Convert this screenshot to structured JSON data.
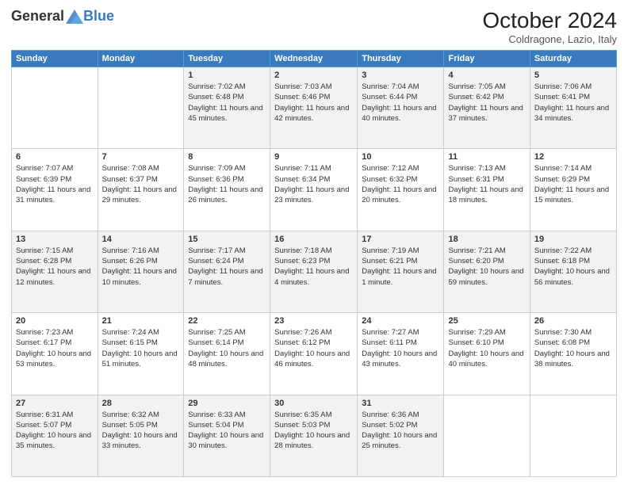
{
  "logo": {
    "general": "General",
    "blue": "Blue"
  },
  "header": {
    "title": "October 2024",
    "subtitle": "Coldragone, Lazio, Italy"
  },
  "days_of_week": [
    "Sunday",
    "Monday",
    "Tuesday",
    "Wednesday",
    "Thursday",
    "Friday",
    "Saturday"
  ],
  "weeks": [
    [
      null,
      null,
      {
        "day": 1,
        "sunrise": "Sunrise: 7:02 AM",
        "sunset": "Sunset: 6:48 PM",
        "daylight": "Daylight: 11 hours and 45 minutes."
      },
      {
        "day": 2,
        "sunrise": "Sunrise: 7:03 AM",
        "sunset": "Sunset: 6:46 PM",
        "daylight": "Daylight: 11 hours and 42 minutes."
      },
      {
        "day": 3,
        "sunrise": "Sunrise: 7:04 AM",
        "sunset": "Sunset: 6:44 PM",
        "daylight": "Daylight: 11 hours and 40 minutes."
      },
      {
        "day": 4,
        "sunrise": "Sunrise: 7:05 AM",
        "sunset": "Sunset: 6:42 PM",
        "daylight": "Daylight: 11 hours and 37 minutes."
      },
      {
        "day": 5,
        "sunrise": "Sunrise: 7:06 AM",
        "sunset": "Sunset: 6:41 PM",
        "daylight": "Daylight: 11 hours and 34 minutes."
      }
    ],
    [
      {
        "day": 6,
        "sunrise": "Sunrise: 7:07 AM",
        "sunset": "Sunset: 6:39 PM",
        "daylight": "Daylight: 11 hours and 31 minutes."
      },
      {
        "day": 7,
        "sunrise": "Sunrise: 7:08 AM",
        "sunset": "Sunset: 6:37 PM",
        "daylight": "Daylight: 11 hours and 29 minutes."
      },
      {
        "day": 8,
        "sunrise": "Sunrise: 7:09 AM",
        "sunset": "Sunset: 6:36 PM",
        "daylight": "Daylight: 11 hours and 26 minutes."
      },
      {
        "day": 9,
        "sunrise": "Sunrise: 7:11 AM",
        "sunset": "Sunset: 6:34 PM",
        "daylight": "Daylight: 11 hours and 23 minutes."
      },
      {
        "day": 10,
        "sunrise": "Sunrise: 7:12 AM",
        "sunset": "Sunset: 6:32 PM",
        "daylight": "Daylight: 11 hours and 20 minutes."
      },
      {
        "day": 11,
        "sunrise": "Sunrise: 7:13 AM",
        "sunset": "Sunset: 6:31 PM",
        "daylight": "Daylight: 11 hours and 18 minutes."
      },
      {
        "day": 12,
        "sunrise": "Sunrise: 7:14 AM",
        "sunset": "Sunset: 6:29 PM",
        "daylight": "Daylight: 11 hours and 15 minutes."
      }
    ],
    [
      {
        "day": 13,
        "sunrise": "Sunrise: 7:15 AM",
        "sunset": "Sunset: 6:28 PM",
        "daylight": "Daylight: 11 hours and 12 minutes."
      },
      {
        "day": 14,
        "sunrise": "Sunrise: 7:16 AM",
        "sunset": "Sunset: 6:26 PM",
        "daylight": "Daylight: 11 hours and 10 minutes."
      },
      {
        "day": 15,
        "sunrise": "Sunrise: 7:17 AM",
        "sunset": "Sunset: 6:24 PM",
        "daylight": "Daylight: 11 hours and 7 minutes."
      },
      {
        "day": 16,
        "sunrise": "Sunrise: 7:18 AM",
        "sunset": "Sunset: 6:23 PM",
        "daylight": "Daylight: 11 hours and 4 minutes."
      },
      {
        "day": 17,
        "sunrise": "Sunrise: 7:19 AM",
        "sunset": "Sunset: 6:21 PM",
        "daylight": "Daylight: 11 hours and 1 minute."
      },
      {
        "day": 18,
        "sunrise": "Sunrise: 7:21 AM",
        "sunset": "Sunset: 6:20 PM",
        "daylight": "Daylight: 10 hours and 59 minutes."
      },
      {
        "day": 19,
        "sunrise": "Sunrise: 7:22 AM",
        "sunset": "Sunset: 6:18 PM",
        "daylight": "Daylight: 10 hours and 56 minutes."
      }
    ],
    [
      {
        "day": 20,
        "sunrise": "Sunrise: 7:23 AM",
        "sunset": "Sunset: 6:17 PM",
        "daylight": "Daylight: 10 hours and 53 minutes."
      },
      {
        "day": 21,
        "sunrise": "Sunrise: 7:24 AM",
        "sunset": "Sunset: 6:15 PM",
        "daylight": "Daylight: 10 hours and 51 minutes."
      },
      {
        "day": 22,
        "sunrise": "Sunrise: 7:25 AM",
        "sunset": "Sunset: 6:14 PM",
        "daylight": "Daylight: 10 hours and 48 minutes."
      },
      {
        "day": 23,
        "sunrise": "Sunrise: 7:26 AM",
        "sunset": "Sunset: 6:12 PM",
        "daylight": "Daylight: 10 hours and 46 minutes."
      },
      {
        "day": 24,
        "sunrise": "Sunrise: 7:27 AM",
        "sunset": "Sunset: 6:11 PM",
        "daylight": "Daylight: 10 hours and 43 minutes."
      },
      {
        "day": 25,
        "sunrise": "Sunrise: 7:29 AM",
        "sunset": "Sunset: 6:10 PM",
        "daylight": "Daylight: 10 hours and 40 minutes."
      },
      {
        "day": 26,
        "sunrise": "Sunrise: 7:30 AM",
        "sunset": "Sunset: 6:08 PM",
        "daylight": "Daylight: 10 hours and 38 minutes."
      }
    ],
    [
      {
        "day": 27,
        "sunrise": "Sunrise: 6:31 AM",
        "sunset": "Sunset: 5:07 PM",
        "daylight": "Daylight: 10 hours and 35 minutes."
      },
      {
        "day": 28,
        "sunrise": "Sunrise: 6:32 AM",
        "sunset": "Sunset: 5:05 PM",
        "daylight": "Daylight: 10 hours and 33 minutes."
      },
      {
        "day": 29,
        "sunrise": "Sunrise: 6:33 AM",
        "sunset": "Sunset: 5:04 PM",
        "daylight": "Daylight: 10 hours and 30 minutes."
      },
      {
        "day": 30,
        "sunrise": "Sunrise: 6:35 AM",
        "sunset": "Sunset: 5:03 PM",
        "daylight": "Daylight: 10 hours and 28 minutes."
      },
      {
        "day": 31,
        "sunrise": "Sunrise: 6:36 AM",
        "sunset": "Sunset: 5:02 PM",
        "daylight": "Daylight: 10 hours and 25 minutes."
      },
      null,
      null
    ]
  ]
}
